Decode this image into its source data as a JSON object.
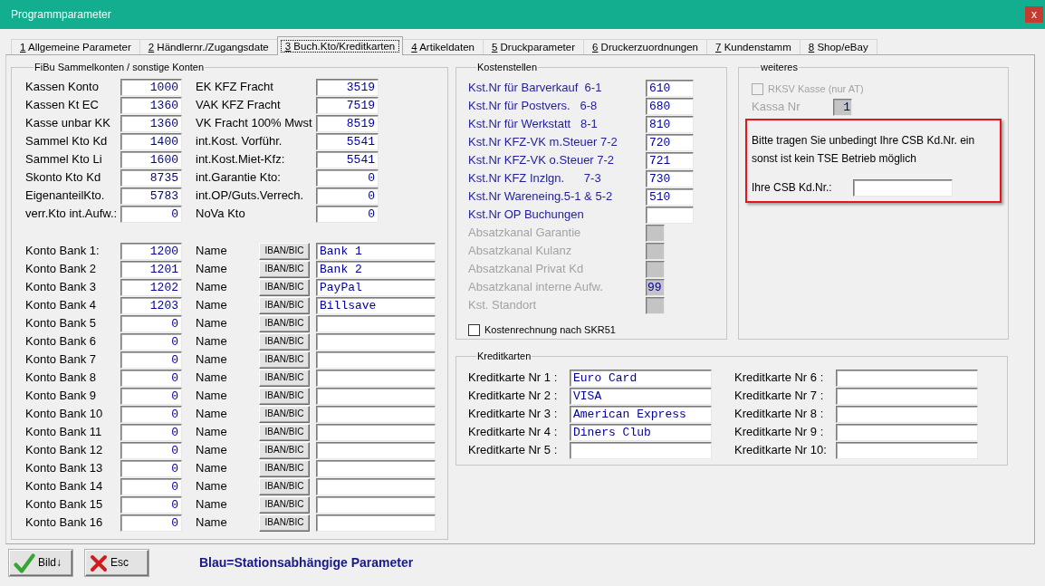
{
  "window": {
    "title": "Programmparameter",
    "close": "x"
  },
  "tabs": [
    {
      "key": "1",
      "label": "Allgemeine Parameter",
      "selected": false
    },
    {
      "key": "2",
      "label": "Händlernr./Zugangsdate",
      "selected": false
    },
    {
      "key": "3",
      "label": "Buch.Kto/Kreditkarten",
      "selected": true
    },
    {
      "key": "4",
      "label": "Artikeldaten",
      "selected": false
    },
    {
      "key": "5",
      "label": "Druckparameter",
      "selected": false
    },
    {
      "key": "6",
      "label": "Druckerzuordnungen",
      "selected": false
    },
    {
      "key": "7",
      "label": "Kundenstamm",
      "selected": false
    },
    {
      "key": "8",
      "label": "Shop/eBay",
      "selected": false
    }
  ],
  "fibu": {
    "title": "FiBu Sammelkonten / sonstige Konten",
    "accounts_left": [
      {
        "label": "Kassen Konto",
        "value": "1000"
      },
      {
        "label": "Kassen Kt EC",
        "value": "1360"
      },
      {
        "label": "Kasse unbar KK",
        "value": "1360"
      },
      {
        "label": "Sammel Kto Kd",
        "value": "1400"
      },
      {
        "label": "Sammel Kto Li",
        "value": "1600"
      },
      {
        "label": "Skonto Kto Kd",
        "value": "8735"
      },
      {
        "label": "EigenanteilKto.",
        "value": "5783"
      },
      {
        "label": "verr.Kto int.Aufw.:",
        "value": "0"
      }
    ],
    "accounts_right": [
      {
        "label": "EK KFZ Fracht",
        "value": "3519"
      },
      {
        "label": "VAK KFZ Fracht",
        "value": "7519"
      },
      {
        "label": "VK Fracht 100% Mwst",
        "value": "8519"
      },
      {
        "label": "int.Kost. Vorführ.",
        "value": "5541"
      },
      {
        "label": "int.Kost.Miet-Kfz:",
        "value": "5541"
      },
      {
        "label": "int.Garantie Kto:",
        "value": "0"
      },
      {
        "label": "int.OP/Guts.Verrech.",
        "value": "0"
      },
      {
        "label": "NoVa Kto",
        "value": "0"
      }
    ],
    "banks": [
      {
        "label": "Konto Bank 1:",
        "account": "1200",
        "name_label": "Name",
        "button": "IBAN/BIC",
        "name": "Bank 1"
      },
      {
        "label": "Konto Bank 2",
        "account": "1201",
        "name_label": "Name",
        "button": "IBAN/BIC",
        "name": "Bank 2"
      },
      {
        "label": "Konto Bank 3",
        "account": "1202",
        "name_label": "Name",
        "button": "IBAN/BIC",
        "name": "PayPal"
      },
      {
        "label": "Konto Bank 4",
        "account": "1203",
        "name_label": "Name",
        "button": "IBAN/BIC",
        "name": "Billsave"
      },
      {
        "label": "Konto Bank 5",
        "account": "0",
        "name_label": "Name",
        "button": "IBAN/BIC"
      },
      {
        "label": "Konto Bank 6",
        "account": "0",
        "name_label": "Name",
        "button": "IBAN/BIC"
      },
      {
        "label": "Konto Bank 7",
        "account": "0",
        "name_label": "Name",
        "button": "IBAN/BIC"
      },
      {
        "label": "Konto Bank 8",
        "account": "0",
        "name_label": "Name",
        "button": "IBAN/BIC"
      },
      {
        "label": "Konto Bank 9",
        "account": "0",
        "name_label": "Name",
        "button": "IBAN/BIC"
      },
      {
        "label": "Konto Bank 10",
        "account": "0",
        "name_label": "Name",
        "button": "IBAN/BIC"
      },
      {
        "label": "Konto Bank 11",
        "account": "0",
        "name_label": "Name",
        "button": "IBAN/BIC"
      },
      {
        "label": "Konto Bank 12",
        "account": "0",
        "name_label": "Name",
        "button": "IBAN/BIC"
      },
      {
        "label": "Konto Bank 13",
        "account": "0",
        "name_label": "Name",
        "button": "IBAN/BIC"
      },
      {
        "label": "Konto Bank 14",
        "account": "0",
        "name_label": "Name",
        "button": "IBAN/BIC"
      },
      {
        "label": "Konto Bank 15",
        "account": "0",
        "name_label": "Name",
        "button": "IBAN/BIC"
      },
      {
        "label": "Konto Bank 16",
        "account": "0",
        "name_label": "Name",
        "button": "IBAN/BIC"
      }
    ]
  },
  "kostenstellen": {
    "title": "Kostenstellen",
    "items": [
      {
        "label": "Kst.Nr für Barverkauf  6-1",
        "value": "610",
        "disabled": false
      },
      {
        "label": "Kst.Nr für Postvers.   6-8",
        "value": "680",
        "disabled": false
      },
      {
        "label": "Kst.Nr für Werkstatt   8-1",
        "value": "810",
        "disabled": false
      },
      {
        "label": "Kst.Nr KFZ-VK m.Steuer 7-2",
        "value": "720",
        "disabled": false
      },
      {
        "label": "Kst.Nr KFZ-VK o.Steuer 7-2",
        "value": "721",
        "disabled": false
      },
      {
        "label": "Kst.Nr KFZ Inzlgn.      7-3",
        "value": "730",
        "disabled": false
      },
      {
        "label": "Kst.Nr Wareneing.5-1 & 5-2",
        "value": "510",
        "disabled": false
      },
      {
        "label": "Kst.Nr OP Buchungen",
        "disabled": false
      },
      {
        "label": "Absatzkanal Garantie",
        "disabled": true
      },
      {
        "label": "Absatzkanal Kulanz",
        "disabled": true
      },
      {
        "label": "Absatzkanal Privat Kd",
        "disabled": true
      },
      {
        "label": "Absatzkanal interne Aufw.",
        "value": "99",
        "disabled": true
      },
      {
        "label": "Kst. Standort",
        "disabled": true
      }
    ],
    "checkbox": {
      "label": "Kostenrechnung nach SKR51",
      "checked": false
    }
  },
  "weiteres": {
    "title": "weiteres",
    "rksv": {
      "label": "RKSV Kasse (nur AT)",
      "checked": false,
      "disabled": true
    },
    "kassa": {
      "label": "Kassa Nr",
      "value": "1",
      "disabled": true
    },
    "notice": {
      "text": "Bitte tragen Sie unbedingt Ihre CSB Kd.Nr. ein sonst ist kein TSE Betrieb möglich",
      "field_label": "Ihre CSB Kd.Nr.:"
    }
  },
  "kreditkarten": {
    "title": "Kreditkarten",
    "cards": [
      {
        "label": "Kreditkarte Nr 1 :",
        "value": "Euro Card"
      },
      {
        "label": "Kreditkarte Nr 2 :",
        "value": "VISA"
      },
      {
        "label": "Kreditkarte Nr 3 :",
        "value": "American Express"
      },
      {
        "label": "Kreditkarte Nr 4 :",
        "value": "Diners Club"
      },
      {
        "label": "Kreditkarte Nr 5 :"
      },
      {
        "label": "Kreditkarte Nr 6 :"
      },
      {
        "label": "Kreditkarte Nr 7 :"
      },
      {
        "label": "Kreditkarte Nr 8 :"
      },
      {
        "label": "Kreditkarte Nr 9 :"
      },
      {
        "label": "Kreditkarte Nr 10:"
      }
    ]
  },
  "buttons": [
    {
      "kind": "confirm",
      "label": "Bild↓"
    },
    {
      "kind": "cancel",
      "label": "Esc"
    }
  ],
  "footer_note": "Blau=Stationsabhängige Parameter"
}
